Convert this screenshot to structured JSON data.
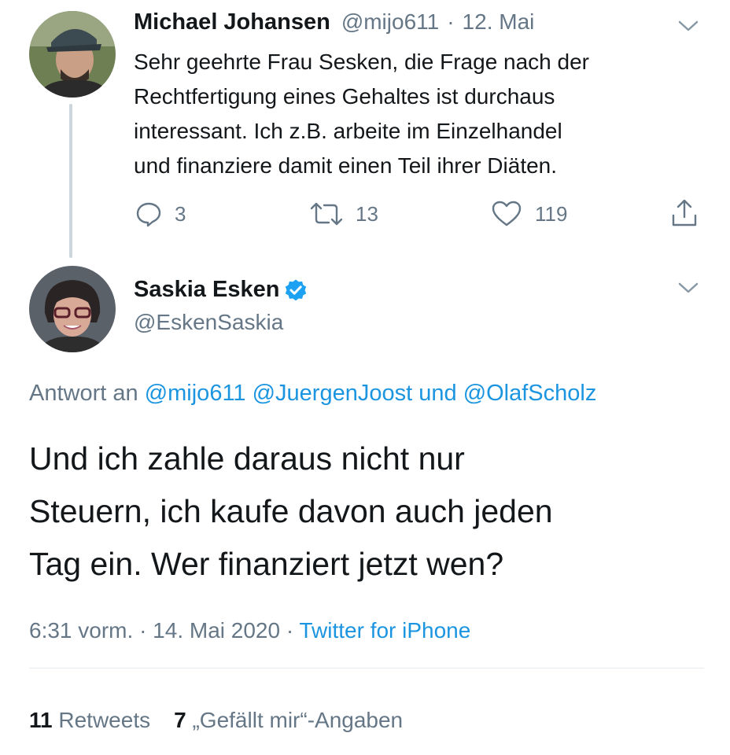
{
  "reply_tweet": {
    "author_name": "Michael Johansen",
    "handle": "@mijo611",
    "separator": "·",
    "date": "12. Mai",
    "body_lines": [
      "Sehr geehrte Frau Sesken, die Frage nach der",
      "Rechtfertigung eines Gehaltes ist durchaus",
      "interessant. Ich z.B. arbeite im Einzelhandel",
      "und finanziere damit einen Teil ihrer Diäten."
    ],
    "actions": {
      "reply_count": "3",
      "retweet_count": "13",
      "like_count": "119"
    }
  },
  "main_tweet": {
    "author_name": "Saskia Esken",
    "handle": "@EskenSaskia",
    "reply_to": {
      "prefix": "Antwort an",
      "mention_1": "@mijo611",
      "mention_2": "@JuergenJoost",
      "connector": "und",
      "mention_3": "@OlafScholz"
    },
    "body_lines": [
      "Und ich zahle daraus nicht nur",
      "Steuern, ich kaufe davon auch jeden",
      "Tag ein. Wer finanziert jetzt wen?"
    ],
    "time": "6:31 vorm.",
    "separator_1": "·",
    "date": "14. Mai 2020",
    "separator_2": "·",
    "source": "Twitter for iPhone",
    "stats": {
      "retweets_count": "11",
      "retweets_label": "Retweets",
      "likes_count": "7",
      "likes_label": "„Gefällt mir“-Angaben"
    }
  },
  "colors": {
    "link": "#1b95e0",
    "muted": "#657786",
    "verified": "#1da1f2",
    "text": "#14171a"
  },
  "icons": [
    "avatar-johansen",
    "chevron-down-icon",
    "reply-icon",
    "retweet-icon",
    "like-icon",
    "share-icon",
    "avatar-esken",
    "verified-badge-icon"
  ]
}
